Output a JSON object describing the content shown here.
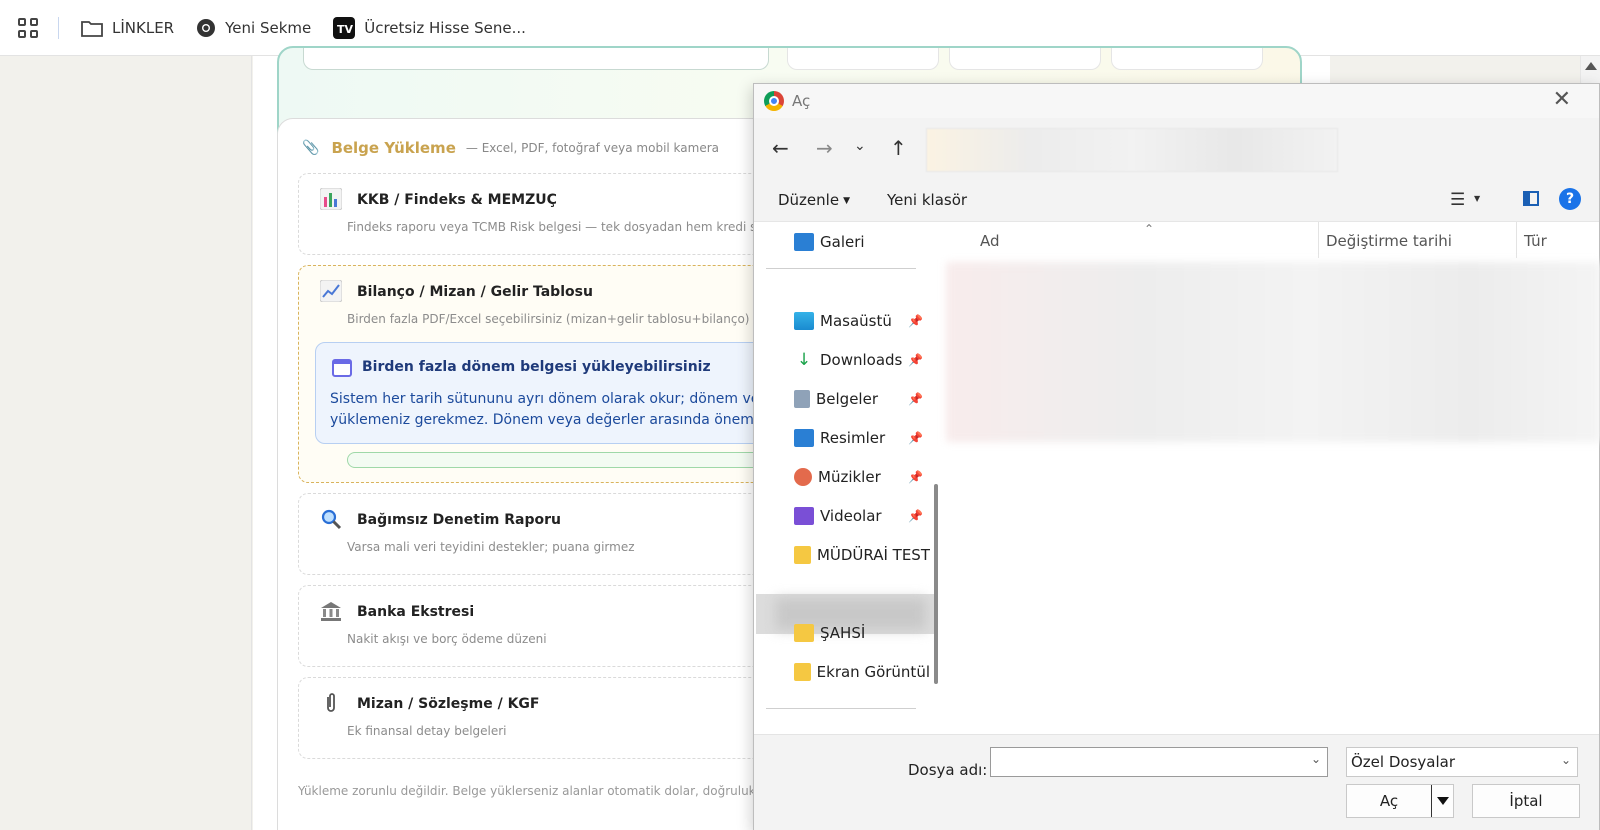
{
  "bookmarks": {
    "items": [
      {
        "label": "LİNKLER",
        "icon": "folder-icon"
      },
      {
        "label": "Yeni Sekme",
        "icon": "chrome-icon"
      },
      {
        "label": "Ücretsiz Hisse Sene...",
        "icon": "tradingview-icon"
      }
    ]
  },
  "page": {
    "upload": {
      "title": "Belge Yükleme",
      "subtitle": "— Excel, PDF, fotoğraf veya mobil kamera",
      "docs": [
        {
          "title": "KKB / Findeks & MEMZUÇ",
          "subtitle": "Findeks raporu veya TCMB Risk belgesi — tek dosyadan hem kredi s",
          "icon": "bar-chart-icon"
        },
        {
          "title": "Bilanço / Mizan / Gelir Tablosu",
          "subtitle": "Birden fazla PDF/Excel seçebilirsiniz (mizan+gelir tablosu+bilanço) —",
          "icon": "line-chart-icon"
        },
        {
          "title": "Bağımsız Denetim Raporu",
          "subtitle": "Varsa mali veri teyidini destekler; puana girmez",
          "icon": "magnifier-icon"
        },
        {
          "title": "Banka Ekstresi",
          "subtitle": "Nakit akışı ve borç ödeme düzeni",
          "icon": "bank-icon"
        },
        {
          "title": "Mizan / Sözleşme / KGF",
          "subtitle": "Ek finansal detay belgeleri",
          "icon": "paperclip-icon"
        }
      ],
      "info": {
        "title": "Birden fazla dönem belgesi yükleyebilirsiniz",
        "line1": "Sistem her tarih sütununu ayrı dönem olarak okur; dönem ve t",
        "line2": "yüklemeniz gerekmez. Dönem veya değerler arasında önemli f"
      },
      "footer": "Yükleme zorunlu değildir. Belge yüklerseniz alanlar otomatik dolar, doğruluk a"
    }
  },
  "dialog": {
    "title": "Aç",
    "toolbar": {
      "organize": "Düzenle",
      "new_folder": "Yeni klasör"
    },
    "nav_pane": [
      {
        "label": "Galeri",
        "icon": "gallery-icon",
        "pinned": false
      },
      {
        "label": "Masaüstü",
        "icon": "desktop-icon",
        "pinned": true
      },
      {
        "label": "Downloads",
        "icon": "download-icon",
        "pinned": true
      },
      {
        "label": "Belgeler",
        "icon": "documents-icon",
        "pinned": true
      },
      {
        "label": "Resimler",
        "icon": "pictures-icon",
        "pinned": true
      },
      {
        "label": "Müzikler",
        "icon": "music-icon",
        "pinned": true
      },
      {
        "label": "Videolar",
        "icon": "videos-icon",
        "pinned": true
      },
      {
        "label": "MÜDÜRAİ TEST",
        "icon": "folder-icon",
        "pinned": false
      },
      {
        "label": "ŞAHSİ",
        "icon": "folder-icon",
        "pinned": false
      },
      {
        "label": "Ekran Görüntül",
        "icon": "folder-icon",
        "pinned": false
      }
    ],
    "columns": {
      "name": "Ad",
      "modified": "Değiştirme tarihi",
      "type": "Tür"
    },
    "filename_label": "Dosya adı:",
    "filename_value": "",
    "filetype": "Özel Dosyalar",
    "open_label": "Aç",
    "cancel_label": "İptal",
    "colors": {
      "accent": "#1a73e8",
      "gold": "#c9a34f"
    }
  }
}
